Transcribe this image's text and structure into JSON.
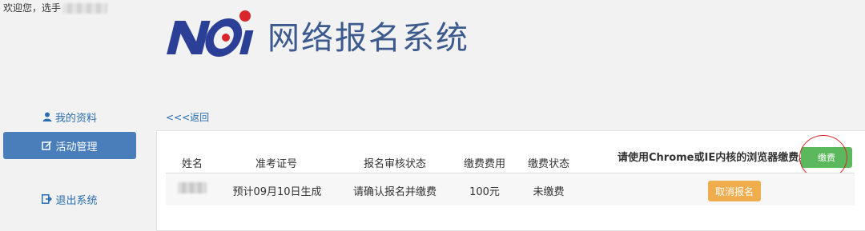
{
  "header": {
    "welcome_text": "欢迎您，选手",
    "system_title": "网络报名系统",
    "logo_text": "NOI"
  },
  "sidebar": {
    "items": [
      {
        "label": "我的资料",
        "icon": "user-icon"
      },
      {
        "label": "活动管理",
        "icon": "edit-icon",
        "active": true
      },
      {
        "label": "退出系统",
        "icon": "logout-icon"
      }
    ]
  },
  "main": {
    "back_link": "<<<返回",
    "notice": "请使用Chrome或IE内核的浏览器缴费。",
    "pay_button": "缴费",
    "table": {
      "headers": [
        "姓名",
        "准考证号",
        "报名审核状态",
        "缴费费用",
        "缴费状态"
      ],
      "row": {
        "exam_id": "预计09月10日生成",
        "review_status": "请确认报名并缴费",
        "fee": "100元",
        "pay_status": "未缴费",
        "action": "取消报名"
      }
    }
  },
  "colors": {
    "title_blue": "#3c5a8e",
    "logo_blue": "#2b3f96",
    "logo_red": "#d9262a",
    "sidebar_active": "#4a7ebb",
    "pay_green": "#5cb85c",
    "cancel_orange": "#f0ad4e"
  }
}
